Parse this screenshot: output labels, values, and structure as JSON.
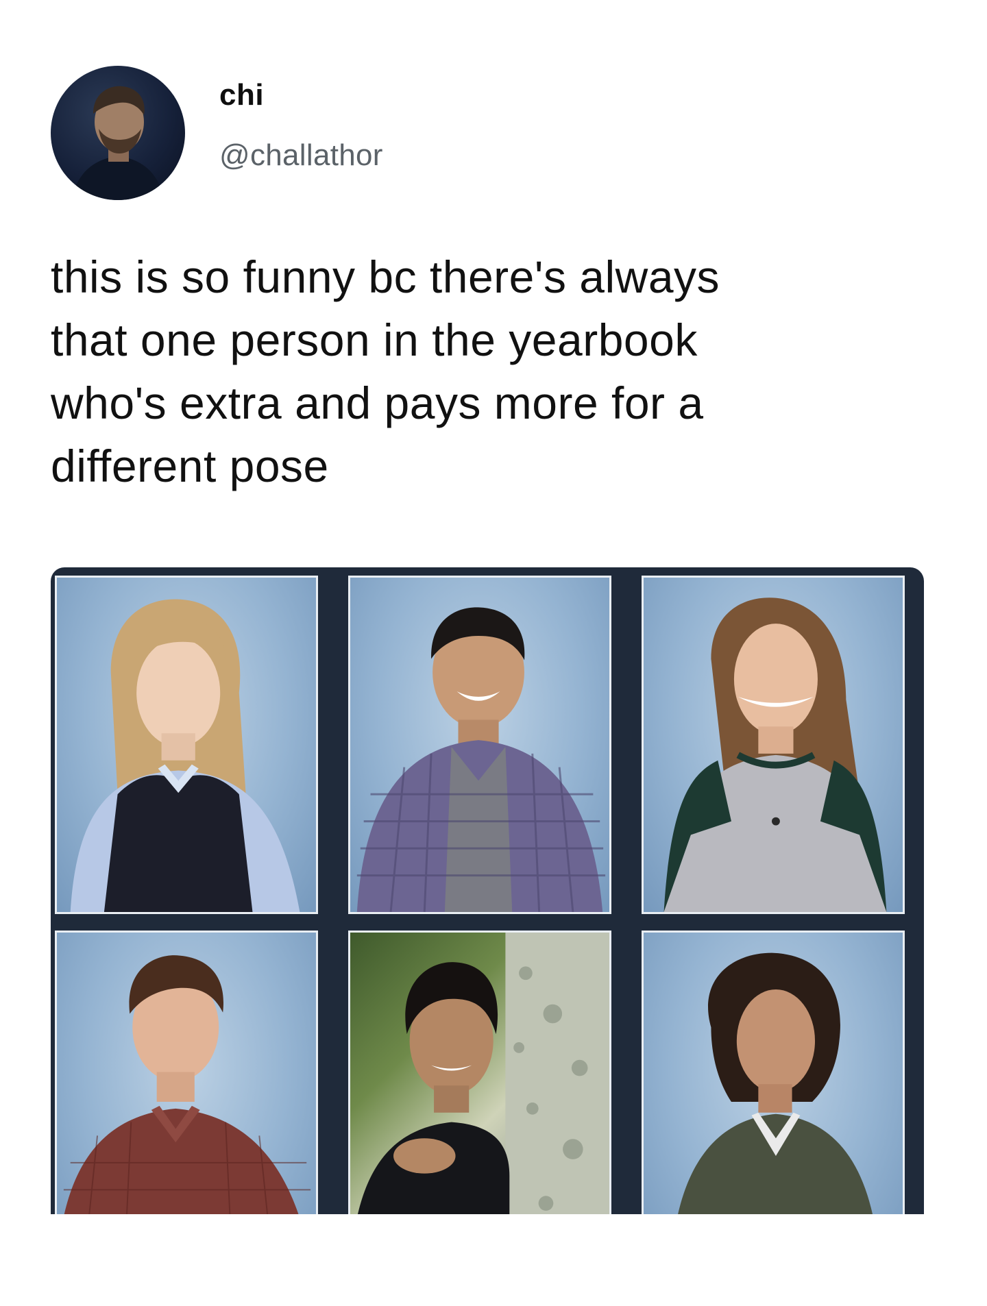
{
  "tweet": {
    "author": {
      "display_name": "chi",
      "handle": "@challathor",
      "avatar_icon": "profile-photo"
    },
    "text_lines": [
      "this is so funny bc there's always",
      "that one person in the yearbook",
      "who's extra and pays more for a",
      "different pose"
    ],
    "media": {
      "type": "image-grid",
      "rows": 2,
      "columns": 3,
      "photos": [
        {
          "id": "photo-1",
          "background": "blue studio"
        },
        {
          "id": "photo-2",
          "background": "blue studio"
        },
        {
          "id": "photo-3",
          "background": "blue studio"
        },
        {
          "id": "photo-4",
          "background": "blue studio"
        },
        {
          "id": "photo-5",
          "background": "outdoor tree"
        },
        {
          "id": "photo-6",
          "background": "blue studio"
        }
      ]
    }
  },
  "colors": {
    "text": "#111111",
    "handle": "#5b6268",
    "grid_frame": "#1f2a3a",
    "studio_blue": "#95b4d2"
  }
}
